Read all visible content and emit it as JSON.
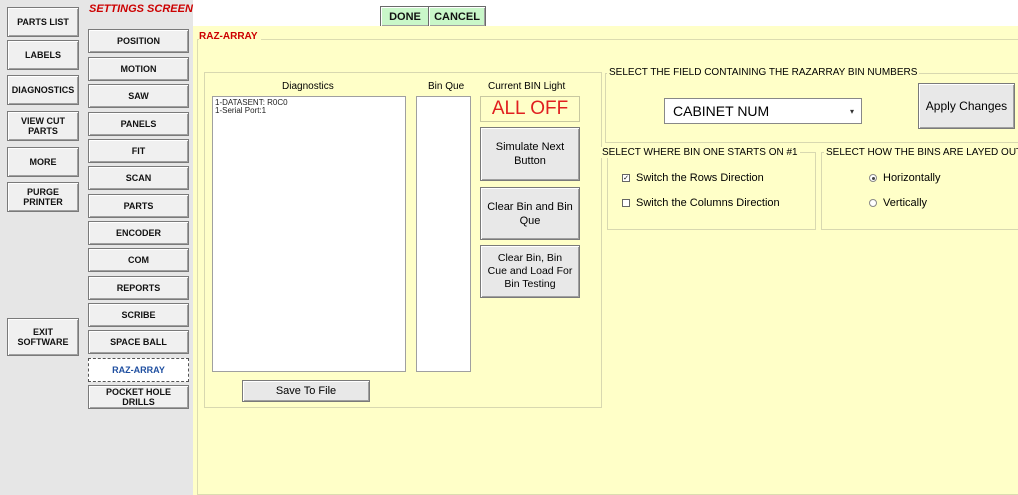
{
  "left_buttons": [
    {
      "label": "PARTS LIST"
    },
    {
      "label": "LABELS"
    },
    {
      "label": "DIAGNOSTICS"
    },
    {
      "label": "VIEW CUT PARTS"
    },
    {
      "label": "MORE"
    },
    {
      "label": "PURGE PRINTER"
    },
    {
      "label": "EXIT SOFTWARE"
    }
  ],
  "settings": {
    "title": "SETTINGS SCREEN",
    "nav": [
      "POSITION",
      "MOTION",
      "SAW",
      "PANELS",
      "FIT",
      "SCAN",
      "PARTS",
      "ENCODER",
      "COM",
      "REPORTS",
      "SCRIBE",
      "SPACE BALL",
      "RAZ-ARRAY",
      "POCKET HOLE DRILLS"
    ],
    "active": "RAZ-ARRAY"
  },
  "toolbar": {
    "done_label": "DONE",
    "cancel_label": "CANCEL"
  },
  "panel": {
    "title": "RAZ-ARRAY",
    "diagnostics_label": "Diagnostics",
    "diagnostics_lines": [
      "1-DATASENT: R0C0",
      "1-Serial Port:1"
    ],
    "bin_que_label": "Bin Que",
    "current_bin_label": "Current BIN Light",
    "current_bin_value": "ALL OFF",
    "simulate_label": "Simulate Next Button",
    "clear_bin_label": "Clear Bin and Bin Que",
    "clear_bin_test_label": "Clear Bin, Bin Cue and Load For Bin Testing",
    "save_label": "Save To File"
  },
  "field_select": {
    "title": "SELECT THE FIELD CONTAINING THE RAZARRAY BIN NUMBERS",
    "selected": "CABINET NUM",
    "apply_label": "Apply Changes"
  },
  "bin_start": {
    "title": "SELECT WHERE BIN ONE STARTS ON #1",
    "options": [
      {
        "label": "Switch the Rows Direction",
        "checked": true
      },
      {
        "label": "Switch the Columns Direction",
        "checked": false
      }
    ]
  },
  "bin_layout": {
    "title": "SELECT HOW THE BINS ARE LAYED OUT",
    "options": [
      {
        "label": "Horizontally",
        "selected": true
      },
      {
        "label": "Vertically",
        "selected": false
      }
    ]
  },
  "colors": {
    "panel_bg": "#ffffc8",
    "accent_red": "#cc0000",
    "done_green": "#c9f7c9",
    "active_blue": "#1f4fa0"
  }
}
